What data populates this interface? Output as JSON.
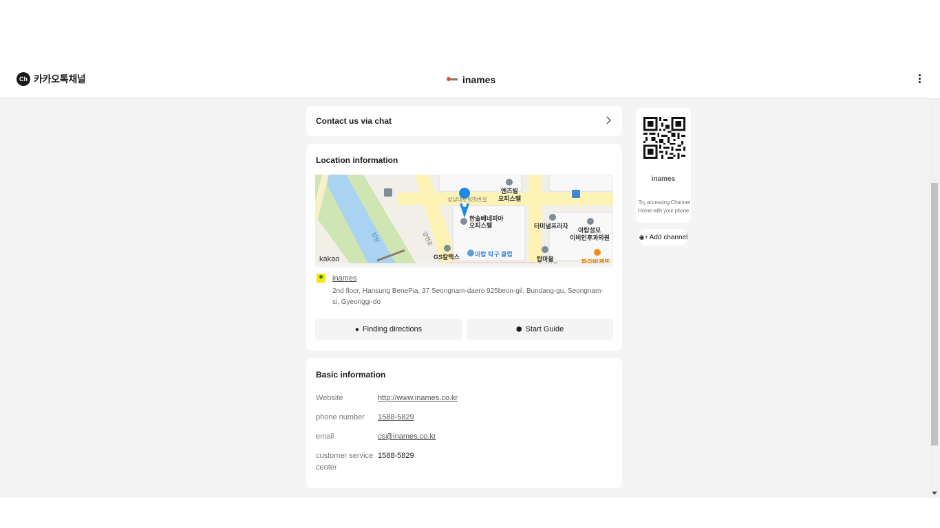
{
  "header": {
    "brand_logo": "Ch",
    "brand_name": "카카오톡채널",
    "channel_name": "inames"
  },
  "chat": {
    "label": "Contact us via chat"
  },
  "location": {
    "title": "Location information",
    "map_labels": {
      "kakao": "kakao",
      "building1": "엔즈빌",
      "building1b": "오피스텔",
      "road1": "성남대로925번길",
      "place_main": "한솔베네피아",
      "place_main_b": "오피스텔",
      "terminal": "터미널프라자",
      "clinic": "아탑성모",
      "clinic_b": "이비인후과의원",
      "gas": "GS칼텍스",
      "club": "아탑 탁구 클럽",
      "tap": "탑마을",
      "tap_b": "오래지약국",
      "bakery": "파리바게뜨",
      "river": "탄천",
      "road2": "양현로"
    },
    "place_name": "inames",
    "address": "2nd floor, Hansung BenePia, 37 Seongnam-daero 925beon-gil, Bundang-gu, Seongnam-si, Gyeonggi-do",
    "directions_label": "Finding directions",
    "guide_label": "Start Guide"
  },
  "basic": {
    "title": "Basic information",
    "rows": [
      {
        "label": "Website",
        "value": "http://www.inames.co.kr"
      },
      {
        "label": "phone number",
        "value": "1588-5829"
      },
      {
        "label": "email",
        "value": "cs@inames.co.kr"
      },
      {
        "label": "customer service center",
        "value": "1588-5829"
      }
    ]
  },
  "qr": {
    "name": "inames",
    "hint": "Try accessing Channel Home with your phone."
  },
  "add_channel": {
    "label": "Add channel"
  },
  "colors": {
    "accent_yellow": "#f7e600",
    "pin_blue": "#1e88e5",
    "page_bg": "#f4f4f4"
  }
}
